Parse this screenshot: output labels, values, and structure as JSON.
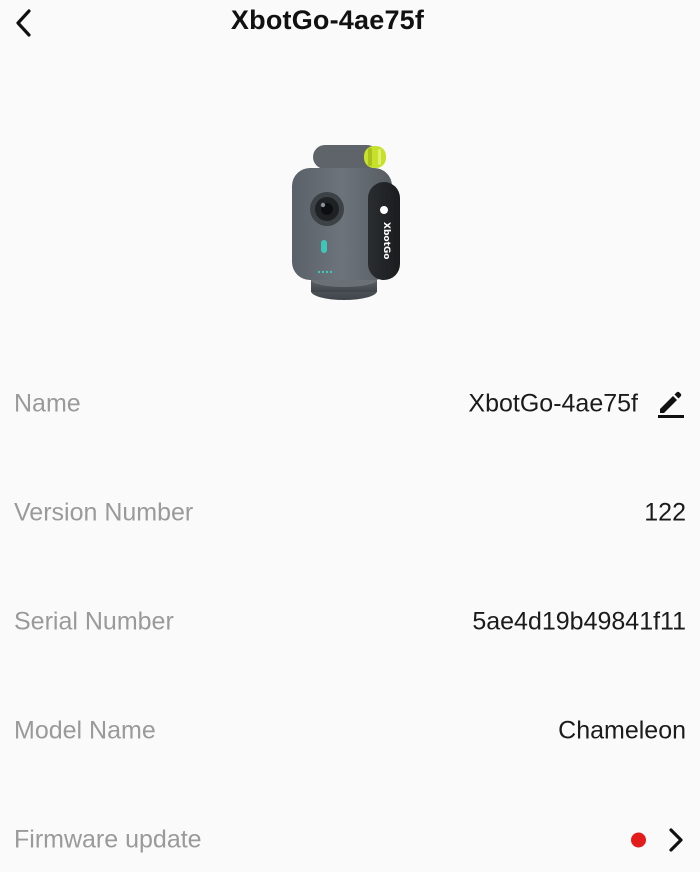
{
  "header": {
    "title": "XbotGo-4ae75f"
  },
  "device": {
    "image_name": "XbotGo Chameleon device image",
    "logo_text": "XbotGo"
  },
  "rows": {
    "name": {
      "label": "Name",
      "value": "XbotGo-4ae75f"
    },
    "version": {
      "label": "Version Number",
      "value": "122"
    },
    "serial": {
      "label": "Serial Number",
      "value": "5ae4d19b49841f11"
    },
    "model": {
      "label": "Model Name",
      "value": "Chameleon"
    },
    "firmware": {
      "label": "Firmware update",
      "has_update": true
    }
  },
  "colors": {
    "background": "#fafafa",
    "label": "#9a9a9a",
    "value": "#1b1b1b",
    "update_dot": "#e31b1b",
    "accent_green": "#c6e02b"
  },
  "icons": {
    "back": "chevron-left-icon",
    "edit": "pencil-icon",
    "forward": "chevron-right-icon"
  }
}
